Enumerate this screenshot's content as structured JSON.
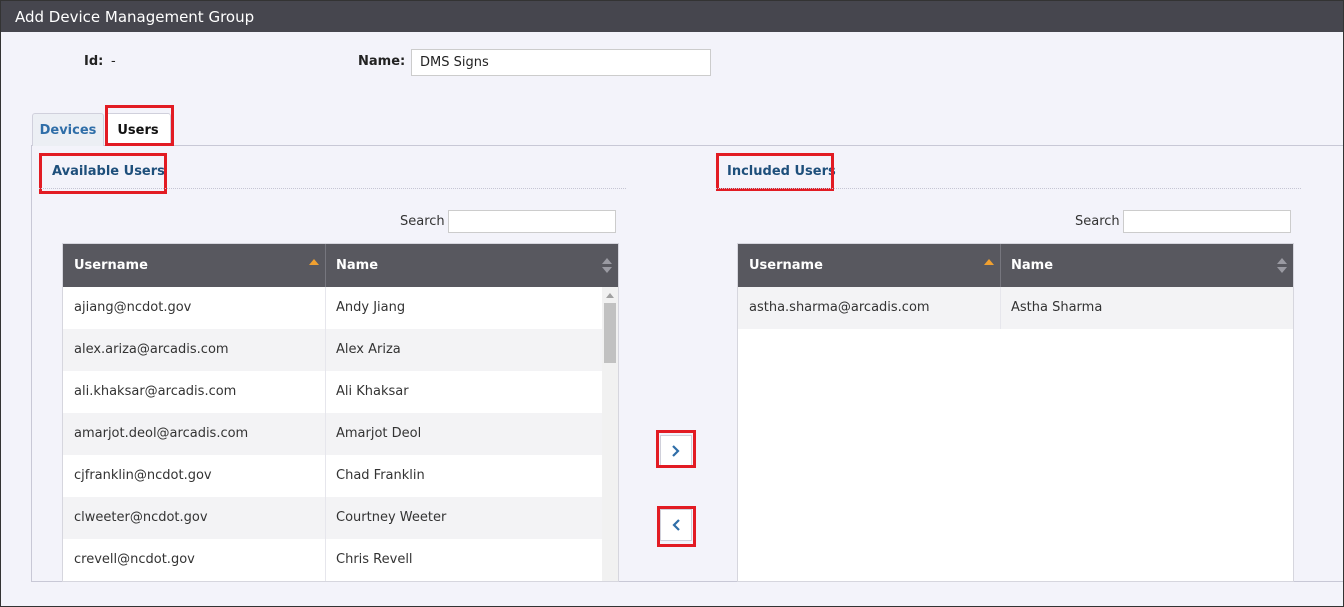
{
  "window": {
    "title": "Add Device Management Group"
  },
  "form": {
    "id_label": "Id:",
    "id_value": "-",
    "name_label": "Name:",
    "name_value": "DMS Signs"
  },
  "tabs": [
    {
      "label": "Devices",
      "active": false
    },
    {
      "label": "Users",
      "active": true
    }
  ],
  "available": {
    "title": "Available Users",
    "search_label": "Search",
    "search_value": "",
    "columns": [
      "Username",
      "Name"
    ],
    "rows": [
      {
        "username": "ajiang@ncdot.gov",
        "name": "Andy Jiang"
      },
      {
        "username": "alex.ariza@arcadis.com",
        "name": "Alex Ariza"
      },
      {
        "username": "ali.khaksar@arcadis.com",
        "name": "Ali Khaksar"
      },
      {
        "username": "amarjot.deol@arcadis.com",
        "name": "Amarjot Deol"
      },
      {
        "username": "cjfranklin@ncdot.gov",
        "name": "Chad Franklin"
      },
      {
        "username": "clweeter@ncdot.gov",
        "name": "Courtney Weeter"
      },
      {
        "username": "crevell@ncdot.gov",
        "name": "Chris Revell"
      }
    ]
  },
  "included": {
    "title": "Included Users",
    "search_label": "Search",
    "search_value": "",
    "columns": [
      "Username",
      "Name"
    ],
    "rows": [
      {
        "username": "astha.sharma@arcadis.com",
        "name": "Astha Sharma"
      }
    ]
  },
  "buttons": {
    "add_icon": "chevron-right-icon",
    "remove_icon": "chevron-left-icon"
  },
  "colors": {
    "titlebar": "#46464e",
    "highlight": "#e21b23",
    "section_title": "#1e4f7b",
    "grid_header": "#58585f",
    "sort_active": "#f0a030"
  }
}
